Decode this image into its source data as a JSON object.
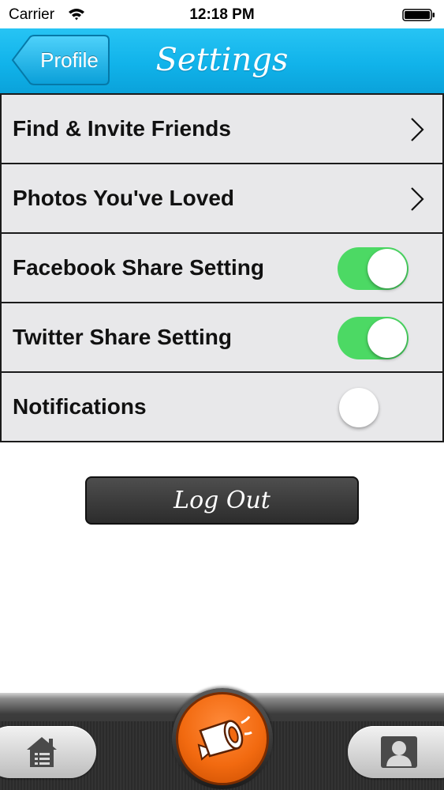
{
  "status_bar": {
    "carrier": "Carrier",
    "time": "12:18 PM"
  },
  "nav": {
    "back_label": "Profile",
    "title": "Settings"
  },
  "settings": [
    {
      "label": "Find & Invite Friends",
      "control": "chevron"
    },
    {
      "label": "Photos You've Loved",
      "control": "chevron"
    },
    {
      "label": "Facebook Share Setting",
      "control": "toggle",
      "on": true
    },
    {
      "label": "Twitter Share Setting",
      "control": "toggle",
      "on": true
    },
    {
      "label": "Notifications",
      "control": "toggle",
      "on": false
    }
  ],
  "logout": {
    "label": "Log Out"
  },
  "tab_bar": {
    "left_icon": "home-icon",
    "center_icon": "megaphone-icon",
    "right_icon": "profile-icon"
  },
  "colors": {
    "nav_bg": "#11b3ea",
    "toggle_on": "#4cd964",
    "center_button": "#f26a10",
    "row_bg": "#e8e8ea"
  }
}
